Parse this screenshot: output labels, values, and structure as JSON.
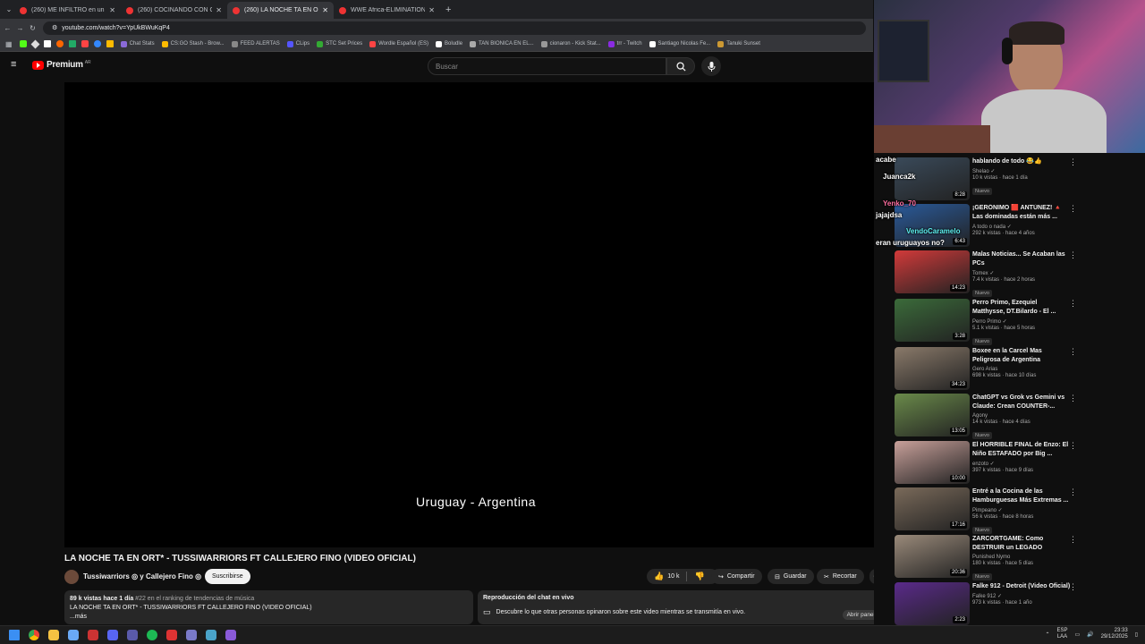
{
  "browser": {
    "tabs": [
      {
        "label": "(260) ME INFILTRO en un SUB...",
        "active": false
      },
      {
        "label": "(260) COCINANDO CON GABI...",
        "active": false
      },
      {
        "label": "(260) LA NOCHE TA EN ORT*",
        "active": true
      },
      {
        "label": "WWE Africa-ELIMINATION MA...",
        "active": false
      }
    ],
    "new_tab": "+",
    "url": "youtube.com/watch?v=YpUkBWuKqP4",
    "bookmarks": [
      "Chat Stats",
      "CS:GO Stash - Brow...",
      "FEED ALERTAS",
      "CLips",
      "STC Set Prices",
      "Wordle Español (ES)",
      "Boludle",
      "TAN BIONICA EN EL...",
      "cionaron - Kick Stat...",
      "trr - Twitch",
      "Santiago Nicolas Fe...",
      "Tanuki Sunset"
    ]
  },
  "youtube": {
    "logo_text": "Premium",
    "region": "AR",
    "search_placeholder": "Buscar"
  },
  "video": {
    "caption": "Uruguay - Argentina",
    "title": "LA NOCHE TA EN ORT* - TUSSIWARRIORS FT CALLEJERO FINO (VIDEO OFICIAL)",
    "channel": "Tussiwarriors ◎ y Callejero Fino ◎",
    "subscribe": "Suscribirse",
    "likes": "10 k",
    "share": "Compartir",
    "save": "Guardar",
    "clip": "Recortar",
    "more": "···",
    "views_meta": "89 k vistas  hace 1 día",
    "ranking": "#22 en el ranking de tendencias de música",
    "desc_line": "LA NOCHE TA EN ORT* - TUSSIWARRIORS FT CALLEJERO FINO (VIDEO OFICIAL)",
    "desc_more": "...más"
  },
  "live_chat": {
    "title": "Reproducción del chat en vivo",
    "text": "Descubre lo que otras personas opinaron sobre este video mientras se transmitía en vivo.",
    "button": "Abrir panel"
  },
  "stream_chat_overlay": [
    "acabe",
    "Juanca2k",
    "Yenko_70",
    "jajajdsa",
    "VendoCaramelo",
    "eran uruguayos no?"
  ],
  "recommendations": [
    {
      "title": "hablando de todo 😂👍",
      "channel": "Shelao ✓",
      "stats": "10 k vistas · hace 1 día",
      "badge": "Nuevo",
      "duration": "8:28",
      "color": "#3a4a5a"
    },
    {
      "title": "¡GERÓNIMO 🟥 ANTÚNEZ! 🔺 Las dominadas están más ...",
      "channel": "A todo o nada ✓",
      "stats": "292 k vistas · hace 4 años",
      "badge": "",
      "duration": "6:43",
      "color": "#2a5a9a"
    },
    {
      "title": "Malas Noticias... Se Acaban las PCs",
      "channel": "Tomex ✓",
      "stats": "7.4 k vistas · hace 2 horas",
      "badge": "Nuevo",
      "duration": "14:23",
      "color": "#d23a3a"
    },
    {
      "title": "Perro Primo, Ezequiel Matthysse, DT.Bilardo - El ...",
      "channel": "Perro Primo ✓",
      "stats": "5.1 k vistas · hace 5 horas",
      "badge": "Nuevo",
      "duration": "3:28",
      "color": "#3b6b3a"
    },
    {
      "title": "Boxee en la Carcel Mas Peligrosa de Argentina",
      "channel": "Gero Arias",
      "stats": "698 k vistas · hace 10 días",
      "badge": "",
      "duration": "34:23",
      "color": "#8a7a6a"
    },
    {
      "title": "ChatGPT vs Grok vs Gemini vs Claude: Crean COUNTER-...",
      "channel": "Agony",
      "stats": "14 k vistas · hace 4 días",
      "badge": "Nuevo",
      "duration": "13:05",
      "color": "#6a8a4a"
    },
    {
      "title": "El HORRIBLE FINAL de Enzo: El Niño ESTAFADO por Big ...",
      "channel": "enzoto ✓",
      "stats": "397 k vistas · hace 9 días",
      "badge": "",
      "duration": "10:00",
      "color": "#c8a09a"
    },
    {
      "title": "Entré a la Cocina de las Hamburguesas Más Extremas ...",
      "channel": "Pimpeano ✓",
      "stats": "56 k vistas · hace 8 horas",
      "badge": "Nuevo",
      "duration": "17:16",
      "color": "#7a6a5a"
    },
    {
      "title": "ZARCORTGAME: Como DESTRUIR un LEGADO",
      "channel": "Punished Nymo",
      "stats": "180 k vistas · hace 5 días",
      "badge": "Nuevo",
      "duration": "20:36",
      "color": "#9a8a7a"
    },
    {
      "title": "Falke 912 - Detroit (Video Oficial)",
      "channel": "Falke 912 ✓",
      "stats": "973 k vistas · hace 1 año",
      "badge": "",
      "duration": "2:23",
      "color": "#5a2a8a"
    }
  ],
  "taskbar": {
    "lang": "ESP",
    "lang2": "LAA",
    "time": "23:33",
    "date": "29/12/2025"
  }
}
